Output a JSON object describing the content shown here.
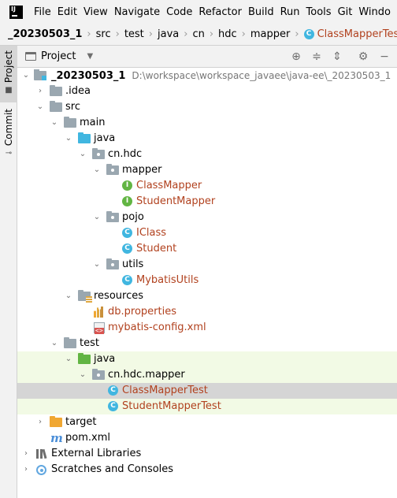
{
  "menu": [
    "File",
    "Edit",
    "View",
    "Navigate",
    "Code",
    "Refactor",
    "Build",
    "Run",
    "Tools",
    "Git",
    "Windo"
  ],
  "breadcrumb": {
    "root": "_20230503_1",
    "parts": [
      "src",
      "test",
      "java",
      "cn",
      "hdc",
      "mapper"
    ],
    "current": "ClassMapperTest"
  },
  "toolstrip": {
    "project": "Project",
    "commit": "Commit"
  },
  "panel": {
    "title": "Project"
  },
  "tree": {
    "root": {
      "label": "_20230503_1",
      "path": "D:\\workspace\\workspace_javaee\\java-ee\\_20230503_1"
    },
    "idea": ".idea",
    "src": "src",
    "main": "main",
    "main_java": "java",
    "cn_hdc": "cn.hdc",
    "mapper": "mapper",
    "class_mapper": "ClassMapper",
    "student_mapper": "StudentMapper",
    "pojo": "pojo",
    "iclass": "IClass",
    "student": "Student",
    "utils": "utils",
    "mybatis_utils": "MybatisUtils",
    "resources": "resources",
    "db_properties": "db.properties",
    "mybatis_config": "mybatis-config.xml",
    "test": "test",
    "test_java": "java",
    "cn_hdc_mapper": "cn.hdc.mapper",
    "class_mapper_test": "ClassMapperTest",
    "student_mapper_test": "StudentMapperTest",
    "target": "target",
    "pom": "pom.xml",
    "ext_libs": "External Libraries",
    "scratches": "Scratches and Consoles"
  },
  "colors": {
    "accent_text": "#b1411e",
    "test_highlight": "#f2fae5",
    "selection": "#d5d5d5"
  }
}
